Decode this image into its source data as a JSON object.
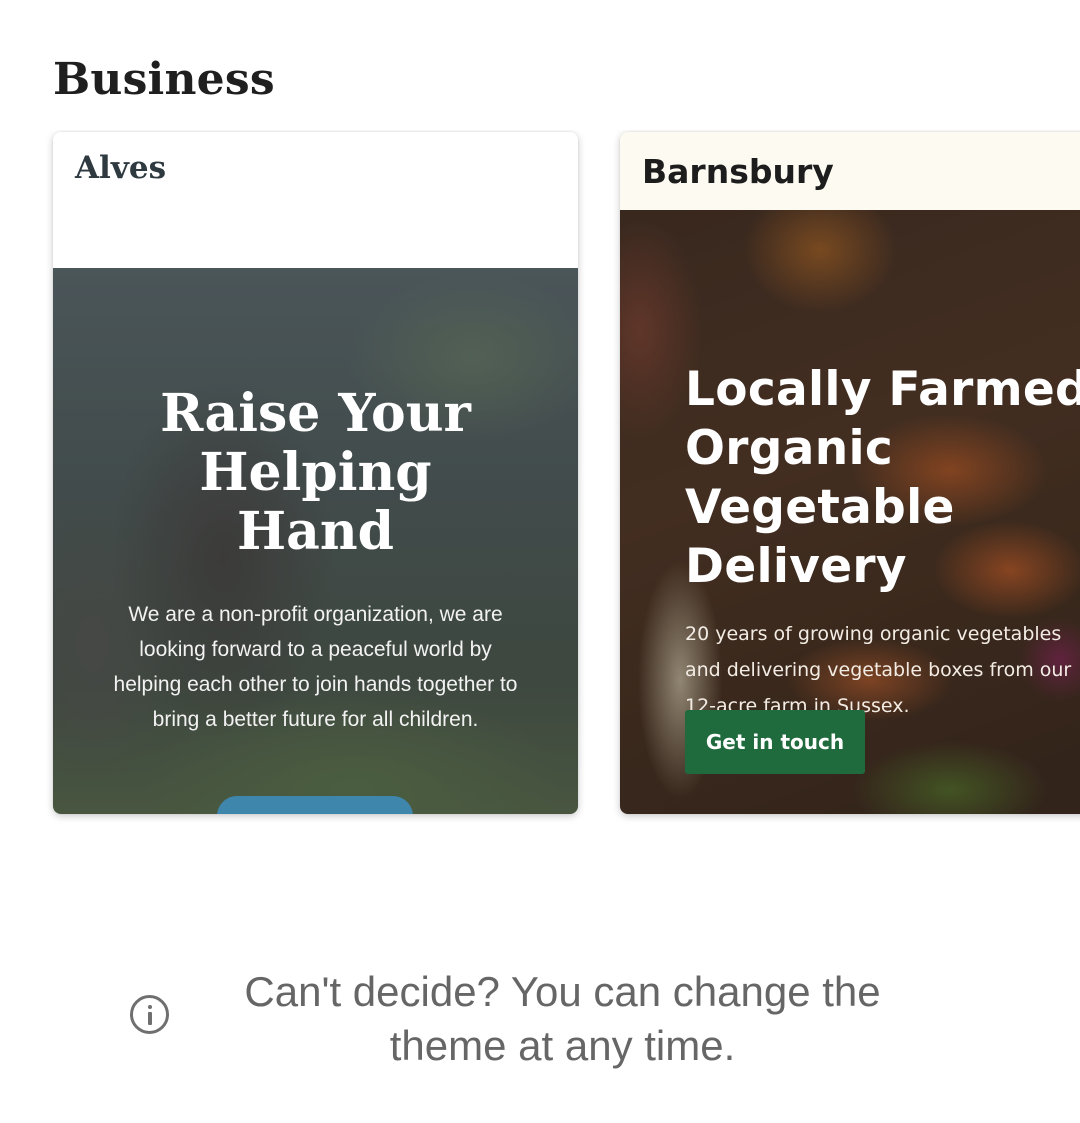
{
  "section": {
    "title": "Business"
  },
  "themes": [
    {
      "name": "Alves",
      "heading": "Raise Your\nHelping\nHand",
      "description": "We are a non-profit organization, we are looking forward to a peaceful world by helping each other to join hands together to bring a better future for all children."
    },
    {
      "name": "Barnsbury",
      "heading": "Locally Farmed\nOrganic\nVegetable\nDelivery",
      "description": "20 years of growing organic vegetables and delivering vegetable boxes from our 12-acre farm in Sussex.",
      "button_label": "Get in touch"
    }
  ],
  "info": {
    "icon": "info-icon",
    "text": "Can't decide? You can change the theme at any time."
  },
  "colors": {
    "alves_button": "#3f86ad",
    "barnsbury_button": "#1f6b3d",
    "info_text": "#666666"
  }
}
